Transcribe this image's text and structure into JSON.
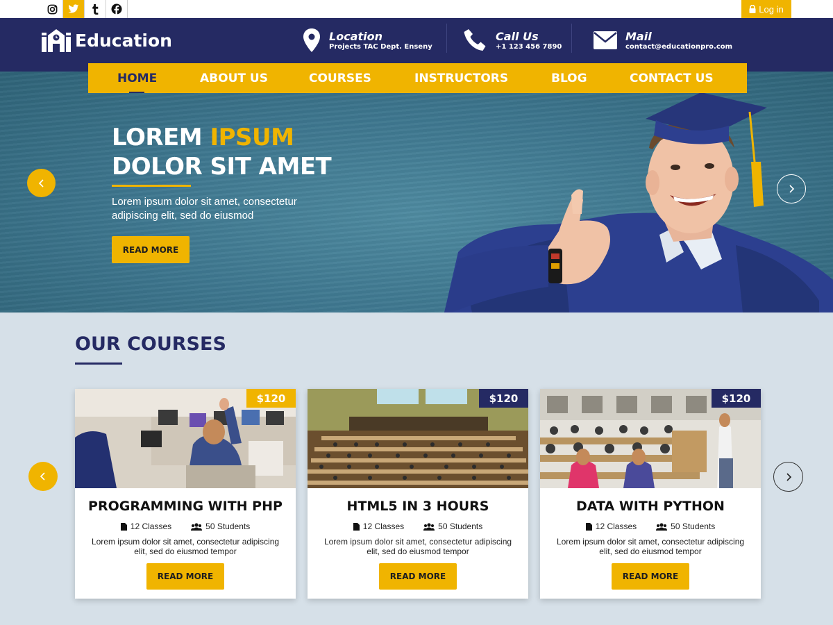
{
  "topbar": {
    "social": [
      {
        "name": "instagram",
        "icon": "instagram-icon"
      },
      {
        "name": "twitter",
        "icon": "twitter-icon",
        "active": true
      },
      {
        "name": "tumblr",
        "icon": "tumblr-icon"
      },
      {
        "name": "facebook",
        "icon": "facebook-icon"
      }
    ],
    "login_label": "Log in"
  },
  "header": {
    "logo_text": "Education",
    "location": {
      "title": "Location",
      "value": "Projects TAC Dept. Enseny"
    },
    "call": {
      "title": "Call Us",
      "value": "+1 123 456 7890"
    },
    "mail": {
      "title": "Mail",
      "value": "contact@educationpro.com"
    }
  },
  "nav": {
    "items": [
      "HOME",
      "ABOUT US",
      "COURSES",
      "INSTRUCTORS",
      "BLOG",
      "CONTACT US"
    ],
    "active": "HOME"
  },
  "hero": {
    "title_white_1": "LOREM",
    "title_yellow": "IPSUM",
    "title_white_2": "DOLOR SIT AMET",
    "text": "Lorem ipsum dolor sit amet, consectetur adipiscing elit, sed do eiusmod",
    "button": "READ MORE"
  },
  "courses": {
    "title": "OUR COURSES",
    "items": [
      {
        "title": "PROGRAMMING WITH PHP",
        "price": "$120",
        "classes": "12 Classes",
        "students": "50 Students",
        "desc": "Lorem ipsum dolor sit amet, consectetur adipiscing elit, sed do eiusmod tempor",
        "button": "READ MORE",
        "price_color": "#f0b400"
      },
      {
        "title": "HTML5 IN 3 HOURS",
        "price": "$120",
        "classes": "12 Classes",
        "students": "50 Students",
        "desc": "Lorem ipsum dolor sit amet, consectetur adipiscing elit, sed do eiusmod tempor",
        "button": "READ MORE",
        "price_color": "#252a63"
      },
      {
        "title": "DATA WITH PYTHON",
        "price": "$120",
        "classes": "12 Classes",
        "students": "50 Students",
        "desc": "Lorem ipsum dolor sit amet, consectetur adipiscing elit, sed do eiusmod tempor",
        "button": "READ MORE",
        "price_color": "#252a63"
      }
    ]
  },
  "colors": {
    "navy": "#252a63",
    "yellow": "#f0b400",
    "bg": "#d6e0e8"
  }
}
